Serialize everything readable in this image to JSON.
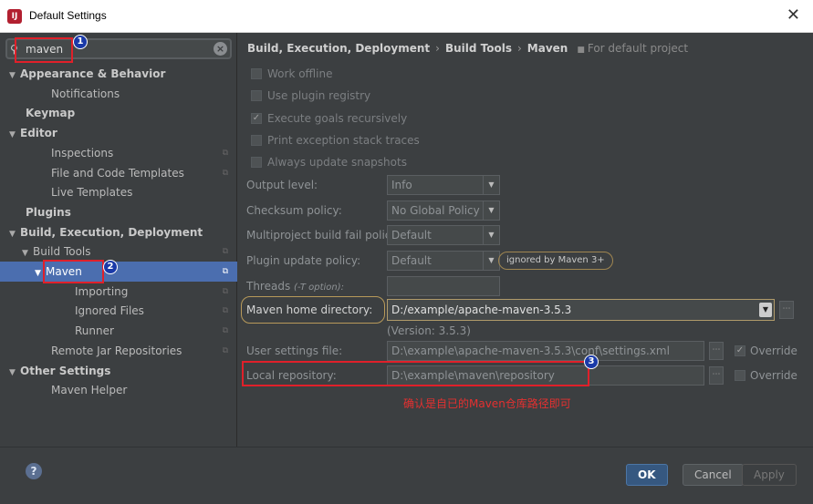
{
  "window": {
    "title": "Default Settings",
    "close_glyph": "✕"
  },
  "search": {
    "value": "maven"
  },
  "tree": [
    {
      "label": "Appearance & Behavior",
      "indent": 0,
      "arrow": true,
      "bold": true
    },
    {
      "label": "Notifications",
      "indent": 2
    },
    {
      "label": "Keymap",
      "indent": 0,
      "bold": true
    },
    {
      "label": "Editor",
      "indent": 0,
      "arrow": true,
      "bold": true
    },
    {
      "label": "Inspections",
      "indent": 2,
      "copy": true
    },
    {
      "label": "File and Code Templates",
      "indent": 2,
      "copy": true
    },
    {
      "label": "Live Templates",
      "indent": 2
    },
    {
      "label": "Plugins",
      "indent": 0,
      "bold": true
    },
    {
      "label": "Build, Execution, Deployment",
      "indent": 0,
      "arrow": true,
      "bold": true
    },
    {
      "label": "Build Tools",
      "indent": 1,
      "arrow": true,
      "copy": true
    },
    {
      "label": "Maven",
      "indent": 2,
      "arrow": true,
      "copy": true,
      "selected": true
    },
    {
      "label": "Importing",
      "indent": 3,
      "copy": true
    },
    {
      "label": "Ignored Files",
      "indent": 3,
      "copy": true
    },
    {
      "label": "Runner",
      "indent": 3,
      "copy": true
    },
    {
      "label": "Remote Jar Repositories",
      "indent": 2,
      "copy": true
    },
    {
      "label": "Other Settings",
      "indent": 0,
      "arrow": true,
      "bold": true
    },
    {
      "label": "Maven Helper",
      "indent": 2
    }
  ],
  "breadcrumb": {
    "part1": "Build, Execution, Deployment",
    "part2": "Build Tools",
    "part3": "Maven",
    "scope": "For default project"
  },
  "checks": [
    {
      "label": "Work offline",
      "checked": false
    },
    {
      "label": "Use plugin registry",
      "checked": false
    },
    {
      "label": "Execute goals recursively",
      "checked": true
    },
    {
      "label": "Print exception stack traces",
      "checked": false
    },
    {
      "label": "Always update snapshots",
      "checked": false
    }
  ],
  "settings": {
    "output_level": {
      "label": "Output level:",
      "value": "Info"
    },
    "checksum_policy": {
      "label": "Checksum policy:",
      "value": "No Global Policy"
    },
    "multiproject_fail": {
      "label": "Multiproject build fail policy:",
      "value": "Default"
    },
    "plugin_update": {
      "label": "Plugin update policy:",
      "value": "Default",
      "note": "ignored by Maven 3+"
    },
    "threads": {
      "label": "Threads",
      "hint": "(-T option):",
      "value": ""
    },
    "maven_home": {
      "label": "Maven home directory:",
      "value": "D:/example/apache-maven-3.5.3",
      "version": "(Version: 3.5.3)"
    },
    "user_settings": {
      "label": "User settings file:",
      "value": "D:\\example\\apache-maven-3.5.3\\conf\\settings.xml",
      "override_label": "Override",
      "override": true
    },
    "local_repo": {
      "label": "Local repository:",
      "value": "D:\\example\\maven\\repository",
      "override_label": "Override",
      "override": false
    }
  },
  "annotation": {
    "note": "确认是自已的Maven仓库路径即可",
    "badges": [
      "1",
      "2",
      "3"
    ]
  },
  "footer": {
    "ok": "OK",
    "cancel": "Cancel",
    "apply": "Apply",
    "help": "?"
  },
  "colors": {
    "accent": "#4b6eaf",
    "annotation_red": "#e0202a",
    "badge_blue": "#1a3aa8",
    "highlight_orange": "#b89a5a"
  }
}
